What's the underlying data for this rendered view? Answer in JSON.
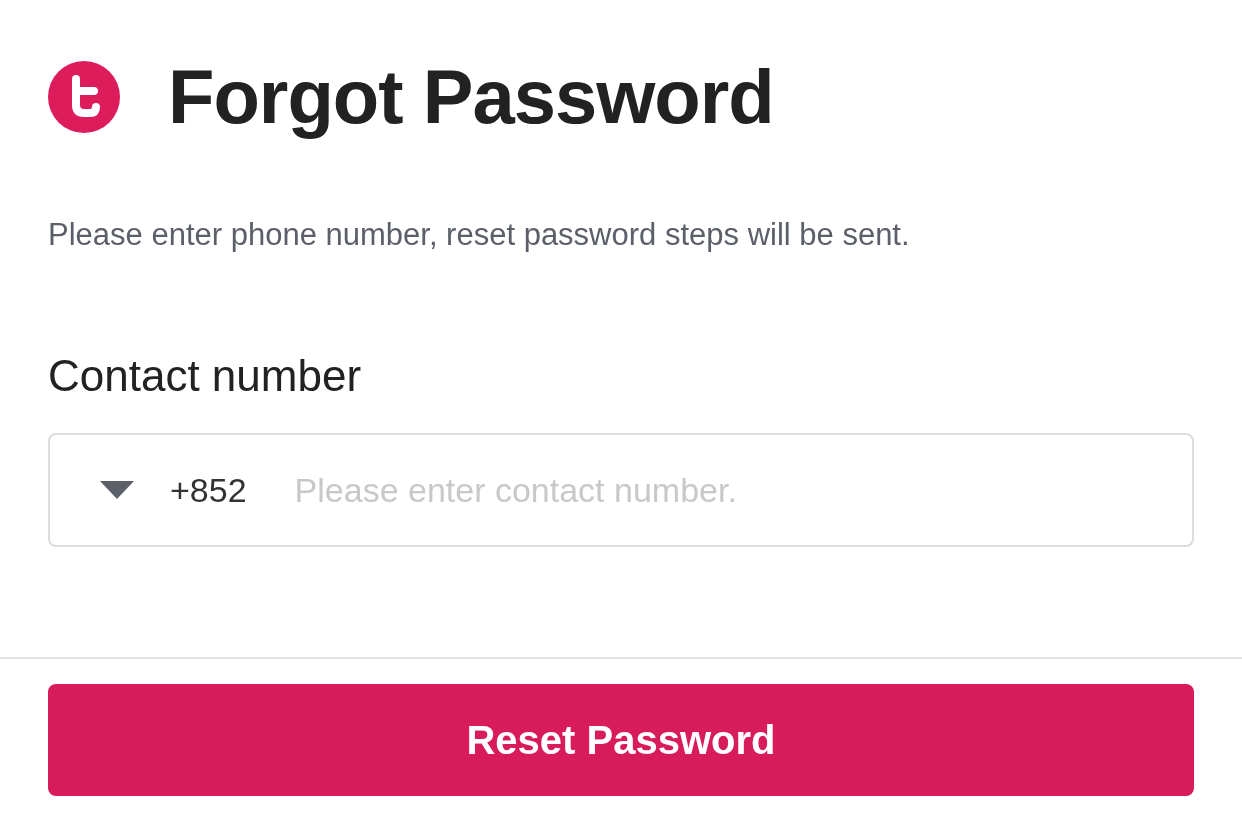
{
  "title": "Forgot Password",
  "description": "Please enter phone number, reset password steps will be sent.",
  "contact_field": {
    "label": "Contact number",
    "country_code": "+852",
    "placeholder": "Please enter contact number."
  },
  "submit_button": {
    "label": "Reset Password"
  }
}
